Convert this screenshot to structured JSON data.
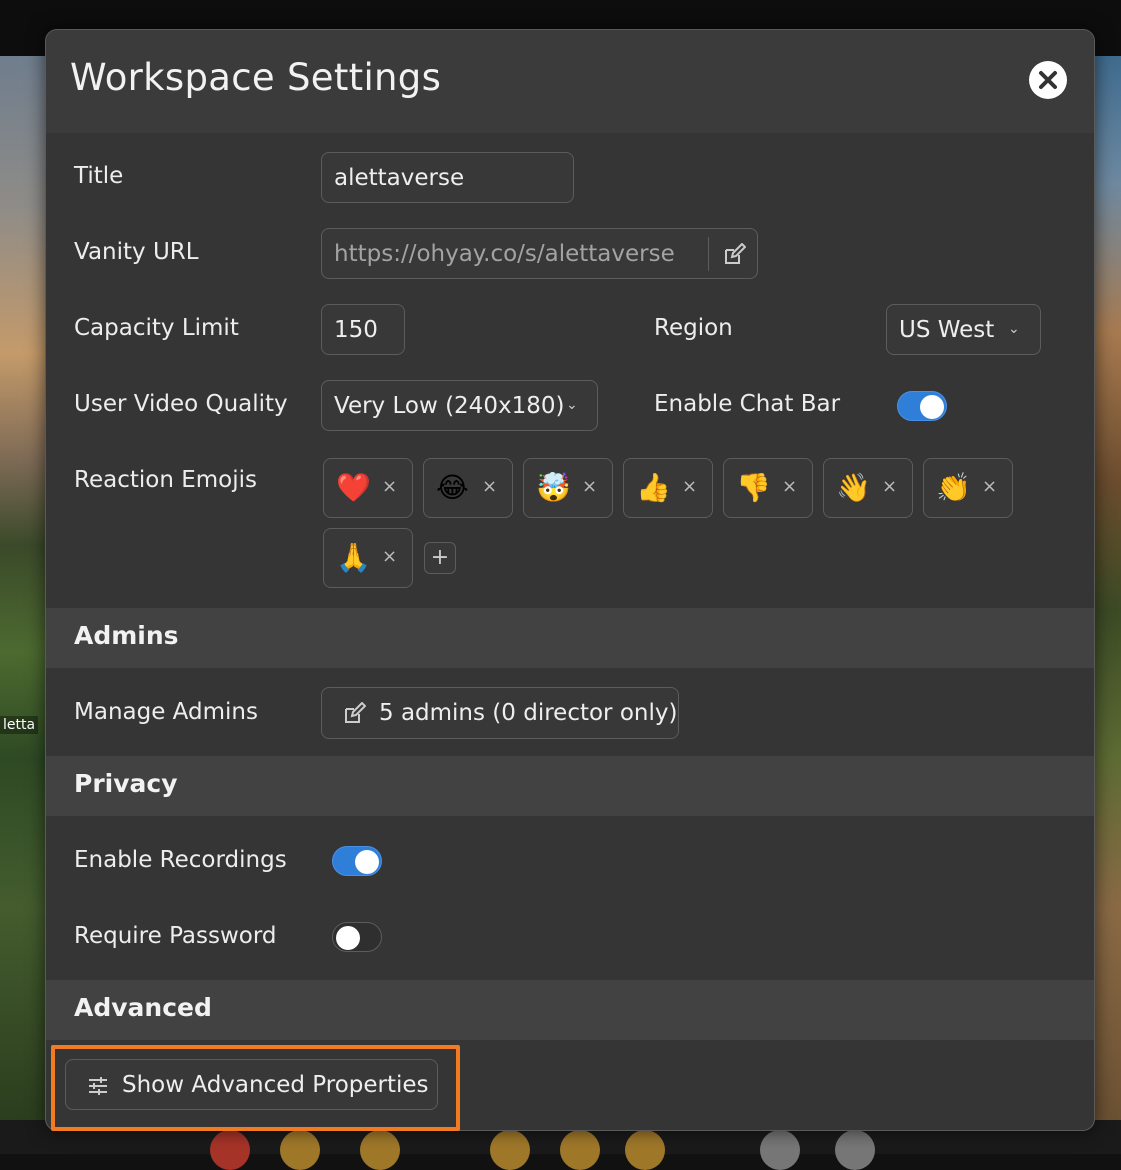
{
  "modal": {
    "title": "Workspace Settings"
  },
  "general": {
    "title_label": "Title",
    "title_value": "alettaverse",
    "vanity_url_label": "Vanity URL",
    "vanity_url_value": "https://ohyay.co/s/alettaverse",
    "capacity_label": "Capacity Limit",
    "capacity_value": "150",
    "region_label": "Region",
    "region_value": "US West",
    "video_quality_label": "User Video Quality",
    "video_quality_value": "Very Low (240x180)",
    "chat_bar_label": "Enable Chat Bar",
    "chat_bar_enabled": true,
    "reaction_label": "Reaction Emojis",
    "reactions": [
      "❤️",
      "😂",
      "🤯",
      "👍",
      "👎",
      "👋",
      "👏",
      "🙏"
    ],
    "remove_glyph": "×",
    "add_glyph": "+"
  },
  "admins": {
    "section_title": "Admins",
    "manage_label": "Manage Admins",
    "manage_button": "5 admins (0 director only)"
  },
  "privacy": {
    "section_title": "Privacy",
    "recordings_label": "Enable Recordings",
    "recordings_enabled": true,
    "password_label": "Require Password",
    "password_enabled": false
  },
  "advanced": {
    "section_title": "Advanced",
    "show_button": "Show Advanced Properties"
  },
  "background": {
    "name_tag": "letta",
    "highlight_color": "#f27b21",
    "toggle_on_color": "#2f7fd9"
  }
}
